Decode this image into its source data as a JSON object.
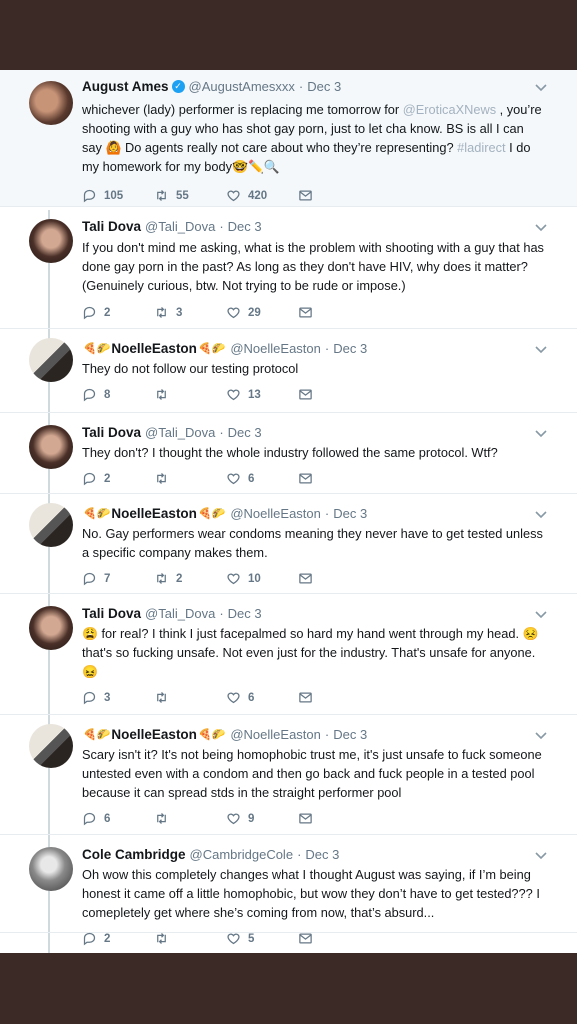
{
  "tweets": [
    {
      "name": "August Ames",
      "handle": "@AugustAmesxxx",
      "date": "Dec 3",
      "verified": true,
      "text_parts": [
        {
          "t": "whichever (lady) performer is replacing me tomorrow for ",
          "link": false
        },
        {
          "t": "@EroticaXNews",
          "link": true
        },
        {
          "t": " , you’re shooting with a guy who has shot gay porn, just to let cha know.  BS is all I can say 🙆 Do agents really not care about who they’re representing? ",
          "link": false
        },
        {
          "t": "#ladirect",
          "link": true
        },
        {
          "t": " I do my homework for my body🤓✏️🔍",
          "link": false
        }
      ],
      "replies": "105",
      "retweets": "55",
      "likes": "420"
    },
    {
      "name": "Tali Dova",
      "handle": "@Tali_Dova",
      "date": "Dec 3",
      "text_parts": [
        {
          "t": "If you don't mind me asking, what is the problem with shooting with a guy that has done gay porn in the past? As long as they don't have HIV, why does it matter? (Genuinely curious, btw. Not trying to be rude or impose.)",
          "link": false
        }
      ],
      "replies": "2",
      "retweets": "3",
      "likes": "29"
    },
    {
      "name": "NoelleEaston",
      "handle": "@NoelleEaston",
      "date": "Dec 3",
      "decorated": true,
      "text_parts": [
        {
          "t": "They do not follow our testing protocol",
          "link": false
        }
      ],
      "replies": "8",
      "retweets": "",
      "likes": "13"
    },
    {
      "name": "Tali Dova",
      "handle": "@Tali_Dova",
      "date": "Dec 3",
      "text_parts": [
        {
          "t": "They don't? I thought the whole industry followed the same protocol. Wtf?",
          "link": false
        }
      ],
      "replies": "2",
      "retweets": "",
      "likes": "6"
    },
    {
      "name": "NoelleEaston",
      "handle": "@NoelleEaston",
      "date": "Dec 3",
      "decorated": true,
      "text_parts": [
        {
          "t": "No. Gay performers wear condoms meaning they never have to get tested unless a specific company makes them.",
          "link": false
        }
      ],
      "replies": "7",
      "retweets": "2",
      "likes": "10"
    },
    {
      "name": "Tali Dova",
      "handle": "@Tali_Dova",
      "date": "Dec 3",
      "text_parts": [
        {
          "t": "😩 for real? I think I just facepalmed so hard my hand went through my head. 😣 that's so fucking unsafe. Not even just for the industry. That's unsafe for anyone. 😖",
          "link": false
        }
      ],
      "replies": "3",
      "retweets": "",
      "likes": "6"
    },
    {
      "name": "NoelleEaston",
      "handle": "@NoelleEaston",
      "date": "Dec 3",
      "decorated": true,
      "text_parts": [
        {
          "t": "Scary isn't it? It's not being homophobic trust me, it's just unsafe to fuck someone untested even with a condom and then go back and fuck people in a tested pool because it can spread stds in the straight performer pool",
          "link": false
        }
      ],
      "replies": "6",
      "retweets": "",
      "likes": "9"
    },
    {
      "name": "Cole Cambridge",
      "handle": "@CambridgeCole",
      "date": "Dec 3",
      "text_parts": [
        {
          "t": "Oh wow this completely changes what I thought August was saying, if I’m being honest it came off a little homophobic, but wow they don’t have to get tested??? I comepletely get where she’s coming from now, that’s absurd...",
          "link": false
        }
      ],
      "replies": "2",
      "retweets": "",
      "likes": "5"
    }
  ],
  "decorations": {
    "lead": "🍕🌮",
    "trail": "🍕🌮"
  },
  "colors": {
    "link": "#a3b2c0",
    "verified": "#1da1f2",
    "muted": "#657786",
    "band": "#3c2a26"
  },
  "icons": [
    "reply-icon",
    "retweet-icon",
    "like-icon",
    "message-icon",
    "chevron-down-icon",
    "verified-icon"
  ]
}
